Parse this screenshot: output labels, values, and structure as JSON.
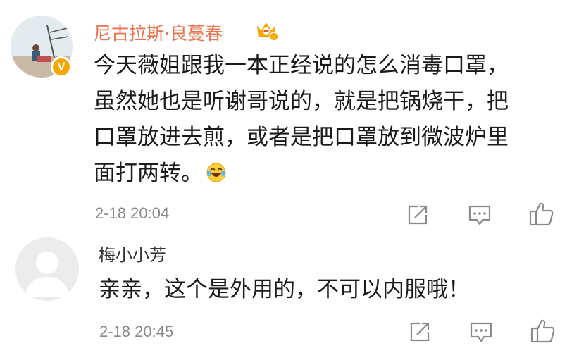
{
  "comments": [
    {
      "username": "尼古拉斯·良蔓春",
      "verified_badge": "V",
      "lines": [
        "今天薇姐跟我一本正经说的怎么消毒口罩，",
        "虽然她也是听谢哥说的，就是把锅烧干，把",
        "口罩放进去煎，或者是把口罩放到微波炉里",
        "面打两转。"
      ],
      "timestamp": "2-18 20:04"
    },
    {
      "username": "梅小小芳",
      "text": "亲亲，这个是外用的，不可以内服哦！",
      "timestamp": "2-18 20:45"
    }
  ],
  "icons": [
    "crown-badge-icon",
    "laughing-emoji-icon",
    "share-icon",
    "comment-icon",
    "like-icon"
  ],
  "colors": {
    "username_accent": "#eb7350",
    "badge": "#f7a600",
    "icon_gray": "#8a8a8a"
  }
}
